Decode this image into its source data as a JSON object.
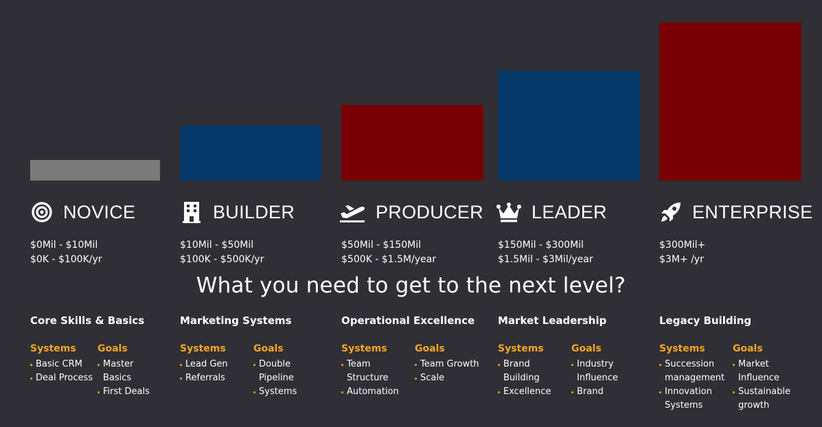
{
  "colors": {
    "background": "#2f2f35",
    "novice_bar": "#7a7a7a",
    "blue_bar": "#053a6a",
    "red_bar": "#790006",
    "accent": "#f5a623"
  },
  "levels": [
    {
      "title": "NOVICE",
      "icon": "target-icon",
      "range1": "$0Mil - $10Mil",
      "range2": "$0K - $100K/yr"
    },
    {
      "title": "BUILDER",
      "icon": "building-icon",
      "range1": "$10Mil - $50Mil",
      "range2": "$100K - $500K/yr"
    },
    {
      "title": "PRODUCER",
      "icon": "plane-departure-icon",
      "range1": "$50Mil - $150Mil",
      "range2": "$500K - $1.5M/year"
    },
    {
      "title": "LEADER",
      "icon": "crown-icon",
      "range1": "$150Mil - $300Mil",
      "range2": "$1.5Mil - $3Mil/year"
    },
    {
      "title": "ENTERPRISE",
      "icon": "rocket-icon",
      "range1": "$300Mil+",
      "range2": "$3M+ /yr"
    }
  ],
  "headline": "What you need to get to the next level?",
  "columns": [
    {
      "title": "Core Skills & Basics",
      "systems_label": "Systems",
      "goals_label": "Goals",
      "systems": [
        "Basic CRM",
        "Deal Process"
      ],
      "goals": [
        "Master Basics",
        "First Deals"
      ]
    },
    {
      "title": "Marketing Systems",
      "systems_label": "Systems",
      "goals_label": "Goals",
      "systems": [
        "Lead Gen",
        "Referrals"
      ],
      "goals": [
        "Double Pipeline",
        "Systems"
      ]
    },
    {
      "title": "Operational Excellence",
      "systems_label": "Systems",
      "goals_label": "Goals",
      "systems": [
        "Team Structure",
        "Automation"
      ],
      "goals": [
        "Team Growth",
        "Scale"
      ]
    },
    {
      "title": "Market Leadership",
      "systems_label": "Systems",
      "goals_label": "Goals",
      "systems": [
        "Brand Building",
        "Excellence"
      ],
      "goals": [
        "Industry Influence",
        "Brand"
      ]
    },
    {
      "title": "Legacy Building",
      "systems_label": "Systems",
      "goals_label": "Goals",
      "systems": [
        "Succession management",
        "Innovation Systems"
      ],
      "goals": [
        "Market Influence",
        "Sustainable growth"
      ]
    }
  ]
}
